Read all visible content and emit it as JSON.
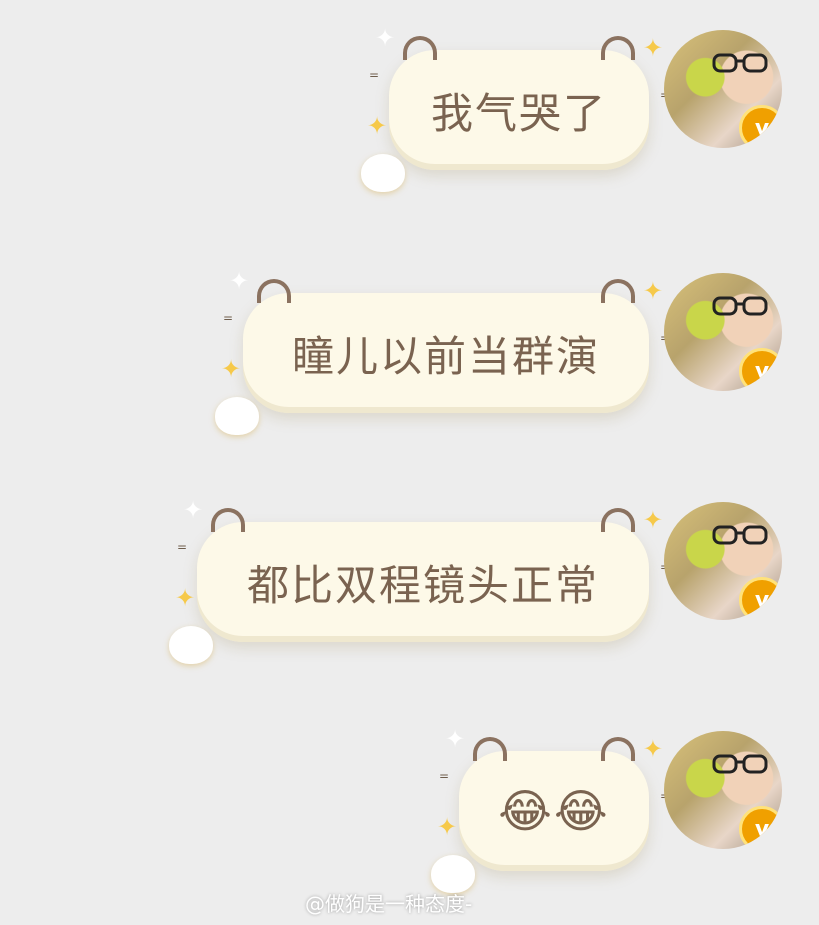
{
  "messages": [
    {
      "text": "我气哭了",
      "icon": "verified-v-badge"
    },
    {
      "text": "瞳儿以前当群演",
      "icon": "verified-v-badge"
    },
    {
      "text": "都比双程镜头正常",
      "icon": "verified-v-badge"
    },
    {
      "text": "😂😂",
      "icon": "verified-v-badge"
    }
  ],
  "badge_label": "v",
  "watermark": "@做狗是一种态度-",
  "colors": {
    "background": "#ededed",
    "bubble": "#fdf9e8",
    "text": "#7a6350",
    "badge": "#f0a000"
  }
}
